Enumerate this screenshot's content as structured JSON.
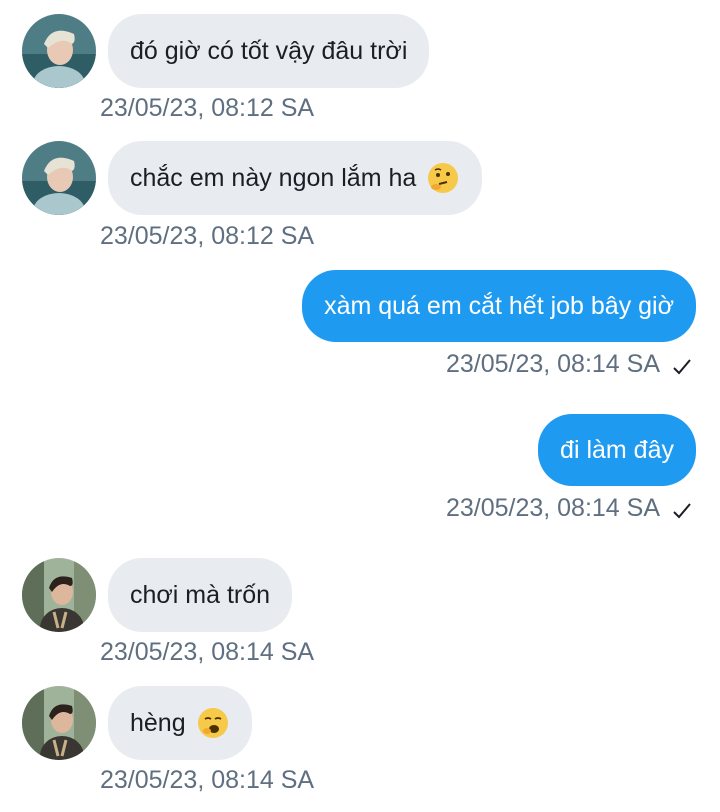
{
  "messages": [
    {
      "direction": "incoming",
      "avatar": "avatar-blond-man",
      "text": "đó giờ có tốt vậy đâu trời",
      "timestamp": "23/05/23, 08:12 SA"
    },
    {
      "direction": "incoming",
      "avatar": "avatar-blond-man",
      "text": "chắc em này ngon lắm ha",
      "emoji": "thinking-face-emoji",
      "timestamp": "23/05/23, 08:12 SA"
    },
    {
      "direction": "outgoing",
      "text": "xàm quá em cắt hết job bây giờ",
      "timestamp": "23/05/23, 08:14 SA",
      "status_icon": "check-icon"
    },
    {
      "direction": "outgoing",
      "text": "đi làm đây",
      "timestamp": "23/05/23, 08:14 SA",
      "status_icon": "check-icon"
    },
    {
      "direction": "incoming",
      "avatar": "avatar-dark-hair",
      "text": "chơi mà trốn",
      "timestamp": "23/05/23, 08:14 SA"
    },
    {
      "direction": "incoming",
      "avatar": "avatar-dark-hair",
      "text": "hèng",
      "emoji": "yawning-face-emoji",
      "timestamp": "23/05/23, 08:14 SA"
    }
  ],
  "colors": {
    "incoming_bubble": "#e8ebf0",
    "outgoing_bubble": "#1e9bf0",
    "timestamp": "#5f6f80"
  }
}
